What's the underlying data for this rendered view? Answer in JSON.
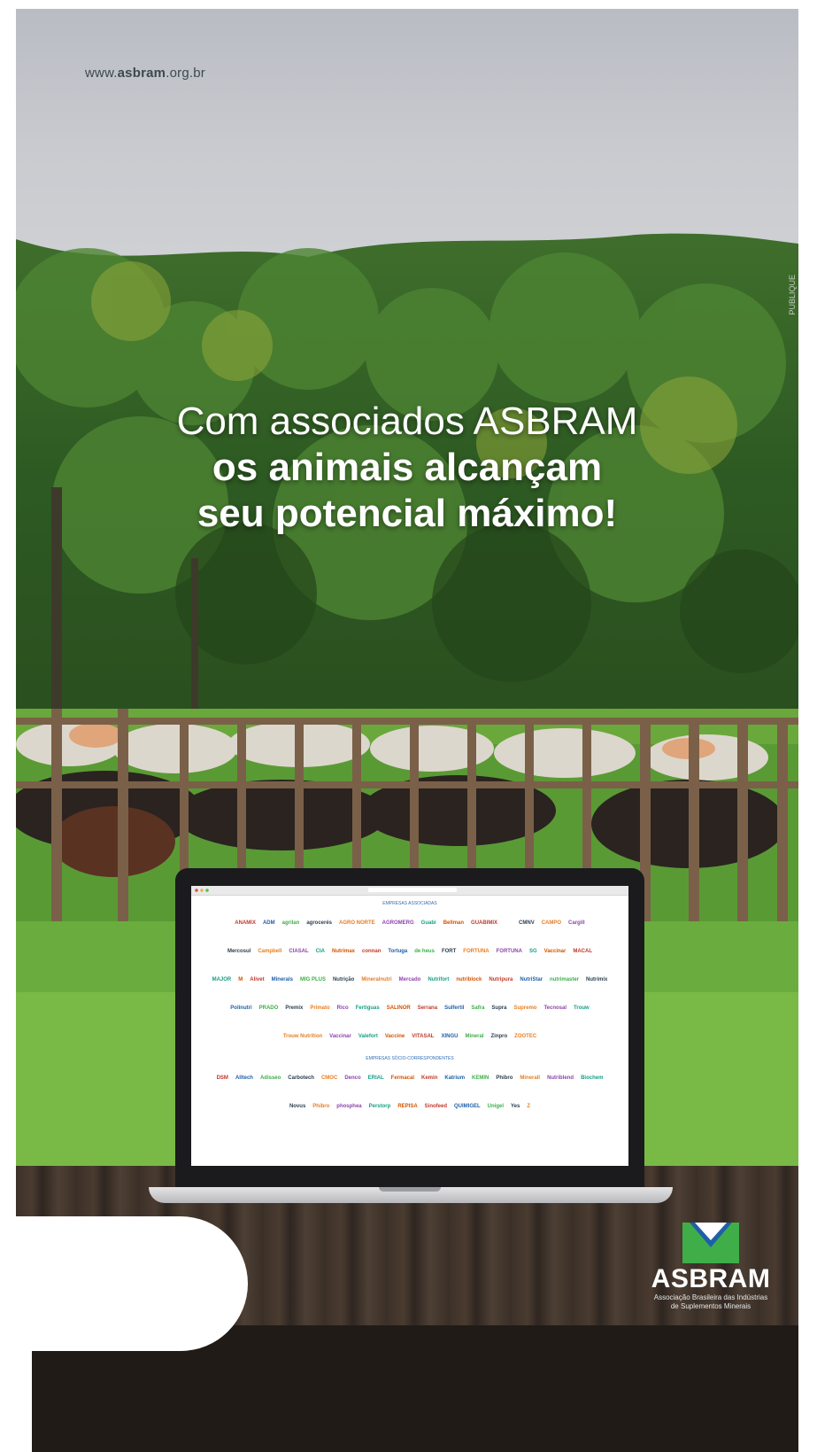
{
  "site_url": {
    "prefix": "www.",
    "domain": "asbram",
    "suffix": ".org.br"
  },
  "headline": {
    "line1": "Com associados ASBRAM",
    "line2": "os animais alcançam",
    "line3": "seu potencial máximo!"
  },
  "photo_credit": "PUBLIQUE",
  "laptop_page": {
    "section_associates": "EMPRESAS ASSOCIADAS",
    "section_correspondents": "EMPRESAS SÓCIO-CORRESPONDENTES",
    "associate_rows": [
      [
        "ANAMIX",
        "ADM",
        "agrilan",
        "agrocerés",
        "AGRO NORTE",
        "AGROMERG",
        "Guabi",
        "Bellman",
        "GUABIMIX",
        "",
        "",
        "CMNV",
        "CAMPO",
        "Cargill"
      ],
      [
        "Mercosul",
        "Campbell",
        "CIASAL",
        "CIA",
        "Nutrimax",
        "connan",
        "Tortuga",
        "de heus",
        "FORT",
        "FORTUNA",
        "FORTUNA",
        "SG",
        "Vaccinar",
        "MACAL"
      ],
      [
        "MAJOR",
        "M",
        "Alivet",
        "Minerals",
        "MIG PLUS",
        "Nutrição",
        "Mineralnutri",
        "Mercado",
        "Nutrifort",
        "nutriblock",
        "Nutripura",
        "NutriStar",
        "nutrimaster",
        "Nutrimix"
      ],
      [
        "Polinutri",
        "PRADO",
        "Premix",
        "Primato",
        "Rico",
        "Fertiguas",
        "SALINOR",
        "Serrana",
        "Sulfertil",
        "Safra",
        "Supra",
        "Supremo",
        "Tecnosal",
        "Trouw"
      ],
      [
        "Trouw Nutrition",
        "Vaccinar",
        "Valefort",
        "Vaccine",
        "VITASAL",
        "XINGU",
        "Mineral",
        "Zinpro",
        "ZOOTEC"
      ]
    ],
    "correspondent_rows": [
      [
        "DSM",
        "Alltech",
        "Adisseo",
        "Carbotech",
        "CMOC",
        "Denco",
        "ERIAL",
        "Fermacal",
        "Kemin",
        "Katrium",
        "KEMIN",
        "Phibro",
        "Minerall",
        "Nutriblend",
        "Biochem"
      ],
      [
        "Novus",
        "Phibro",
        "phosphea",
        "Perstorp",
        "REPISA",
        "Sinofeed",
        "QUIMIGEL",
        "Unigel",
        "Yes",
        "Z"
      ]
    ]
  },
  "brand": {
    "name": "ASBRAM",
    "subtitle_line1": "Associação Brasileira das Indústrias",
    "subtitle_line2": "de Suplementos Minerais"
  },
  "colors": {
    "brand_green": "#3fae49",
    "brand_blue": "#1f5fa8",
    "text_light": "#ffffff"
  }
}
